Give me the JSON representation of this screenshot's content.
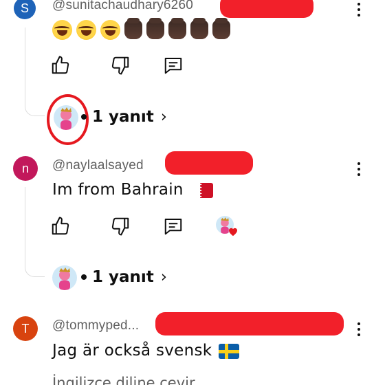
{
  "comments": [
    {
      "avatar_letter": "S",
      "avatar_color": "#1e63b8",
      "handle": "@sunitachaudhary6260",
      "text": "",
      "emoji_sequence": [
        "face-with-tears-of-joy",
        "face-with-tears-of-joy",
        "face-with-tears-of-joy",
        "raised-fist-dark",
        "raised-fist-dark",
        "raised-fist-dark",
        "raised-fist-dark",
        "raised-fist-dark"
      ],
      "replies_label": "1 yanıt"
    },
    {
      "avatar_letter": "n",
      "avatar_color": "#c2185b",
      "handle": "@naylaalsayed",
      "text": "Im from Bahrain",
      "flag": "bahrain-flag",
      "replies_label": "1 yanıt"
    },
    {
      "avatar_letter": "T",
      "avatar_color": "#d8430f",
      "handle": "@tommyped...",
      "text": "Jag är också svensk",
      "flag": "sweden-flag",
      "translate_label": "İngilizce diline çevir"
    }
  ],
  "icons": {
    "like": "thumbs-up-icon",
    "dislike": "thumbs-down-icon",
    "reply": "comment-icon",
    "more": "more-vert-icon",
    "chevron": "chevron-right-icon"
  },
  "colors": {
    "redaction": "#f2202a",
    "highlight_circle": "#e5181f"
  }
}
